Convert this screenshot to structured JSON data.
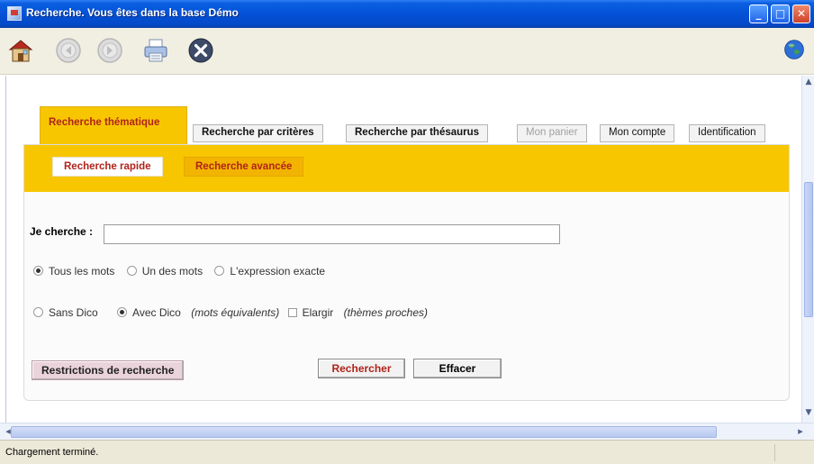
{
  "window": {
    "title": "Recherche. Vous êtes dans la base Démo",
    "controls": [
      "minimize",
      "maximize",
      "close"
    ]
  },
  "toolbar": {
    "icons": [
      "home-icon",
      "back-icon",
      "forward-icon",
      "print-icon",
      "close-circle-icon",
      "globe-icon"
    ]
  },
  "tabs": [
    {
      "label": "Recherche thématique",
      "state": "active"
    },
    {
      "label": "Recherche par critères",
      "state": "normal"
    },
    {
      "label": "Recherche par thésaurus",
      "state": "normal"
    },
    {
      "label": "Mon panier",
      "state": "disabled"
    },
    {
      "label": "Mon compte",
      "state": "normal"
    },
    {
      "label": "Identification",
      "state": "normal"
    }
  ],
  "subtabs": [
    {
      "label": "Recherche rapide",
      "state": "active"
    },
    {
      "label": "Recherche avancée",
      "state": "inactive"
    }
  ],
  "form": {
    "search_label": "Je cherche :",
    "search_value": "",
    "match_options": [
      {
        "label": "Tous les mots",
        "checked": true
      },
      {
        "label": "Un des mots",
        "checked": false
      },
      {
        "label": "L'expression exacte",
        "checked": false
      }
    ],
    "dico_options": {
      "sans_dico": {
        "label": "Sans Dico",
        "checked": false
      },
      "avec_dico": {
        "label": "Avec Dico",
        "checked": true,
        "note": "(mots équivalents)"
      },
      "elargir": {
        "label": "Elargir",
        "checked": false,
        "note": "(thèmes proches)"
      }
    },
    "restrictions_button": "Restrictions de recherche",
    "search_button": "Rechercher",
    "clear_button": "Effacer"
  },
  "statusbar": {
    "text": "Chargement terminé."
  },
  "colors": {
    "accent": "#f7c600",
    "accent_text": "#b0231a",
    "titlebar": "#0451d6"
  }
}
